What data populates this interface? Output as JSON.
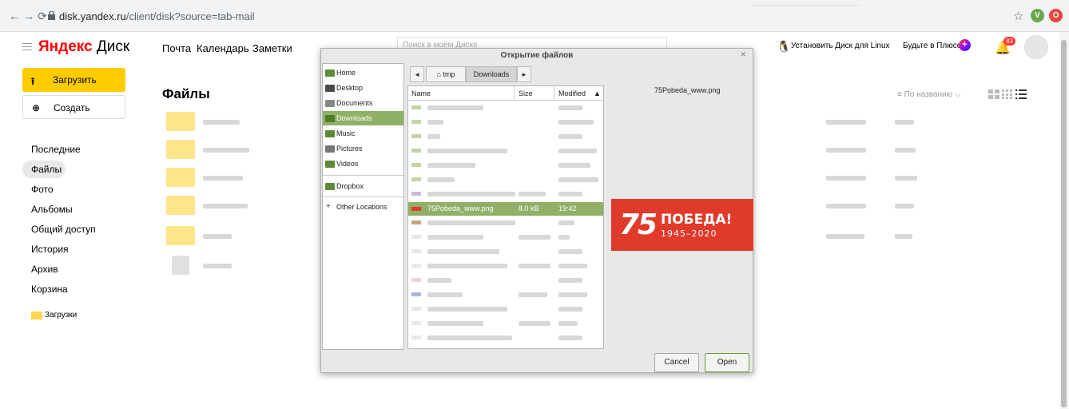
{
  "browser": {
    "url_host": "disk.yandex.ru",
    "url_path": "/client/disk?source=tab-mail",
    "ext_v_label": "V",
    "ext_o_label": "O"
  },
  "header": {
    "logo_ya": "Яндекс",
    "logo_disk": "Диск",
    "links": [
      "Почта",
      "Календарь",
      "Заметки"
    ],
    "search_placeholder": "Поиск в моём Диске",
    "install_linux": "Установить Диск для Linux",
    "be_plus": "Будьте в Плюсе",
    "notifications_count": "83"
  },
  "sidebar": {
    "upload_label": "Загрузить",
    "create_label": "Создать",
    "items": [
      "Последние",
      "Файлы",
      "Фото",
      "Альбомы",
      "Общий доступ",
      "История",
      "Архив",
      "Корзина"
    ],
    "folder_label": "Загрузки"
  },
  "content": {
    "title": "Файлы",
    "sort_label": "По названию"
  },
  "dialog": {
    "title": "Открытие файлов",
    "places": [
      "Home",
      "Desktop",
      "Documents",
      "Downloads",
      "Music",
      "Pictures",
      "Videos",
      "Dropbox",
      "Other Locations"
    ],
    "active_place": "Downloads",
    "path": [
      "tmp",
      "Downloads"
    ],
    "columns": {
      "name": "Name",
      "size": "Size",
      "modified": "Modified"
    },
    "selected_file": {
      "name": "75Pobeda_www.png",
      "size": "8.0 kB",
      "modified": "19:42"
    },
    "preview_filename": "75Pobeda_www.png",
    "preview_logo": {
      "number": "75",
      "word": "ПОБЕДА!",
      "years": "1945–2020"
    },
    "cancel_label": "Cancel",
    "open_label": "Open"
  },
  "colors": {
    "accent_yellow": "#ffcc00",
    "selection_green": "#8fb067",
    "pobeda_red": "#e03a2b"
  }
}
